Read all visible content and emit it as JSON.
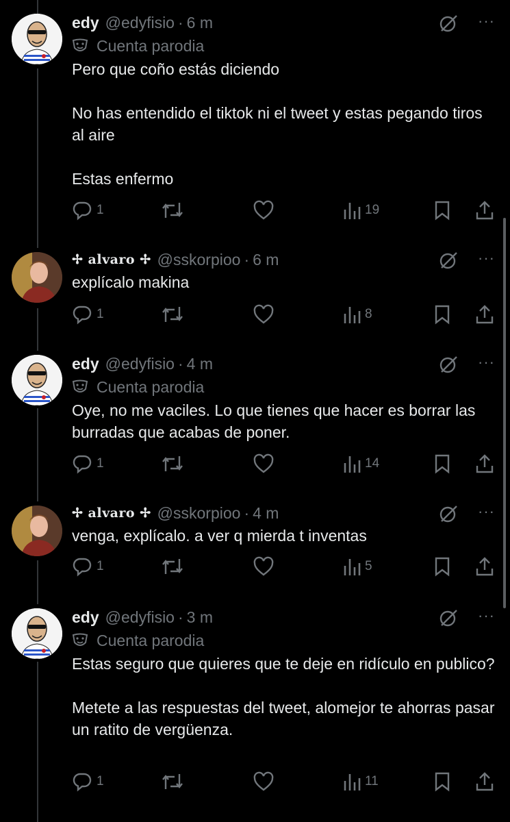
{
  "tweets": [
    {
      "name": "edy",
      "handle": "@edyfisio",
      "time": "6 m",
      "parody_label": "Cuenta parodia",
      "text": "Pero que coño estás diciendo\n\nNo has entendido el tiktok ni el tweet y estas pegando tiros al aire\n\nEstas enfermo",
      "replies": "1",
      "retweets": "",
      "likes": "",
      "views": "19"
    },
    {
      "name": "✢ alvaro ✢",
      "handle": "@sskorpioo",
      "time": "6 m",
      "text": "explícalo makina",
      "replies": "1",
      "retweets": "",
      "likes": "",
      "views": "8"
    },
    {
      "name": "edy",
      "handle": "@edyfisio",
      "time": "4 m",
      "parody_label": "Cuenta parodia",
      "text": "Oye, no me vaciles. Lo que tienes que hacer es borrar las burradas que acabas de poner.",
      "replies": "1",
      "retweets": "",
      "likes": "",
      "views": "14"
    },
    {
      "name": "✢ alvaro ✢",
      "handle": "@sskorpioo",
      "time": "4 m",
      "text": "venga, explícalo. a ver q mierda t inventas",
      "replies": "1",
      "retweets": "",
      "likes": "",
      "views": "5"
    },
    {
      "name": "edy",
      "handle": "@edyfisio",
      "time": "3 m",
      "parody_label": "Cuenta parodia",
      "text": "Estas seguro que quieres que te deje en ridículo en publico?\n\nMetete a las respuestas del tweet, alomejor te ahorras pasar un ratito de vergüenza.",
      "replies": "1",
      "retweets": "",
      "likes": "",
      "views": "11"
    }
  ],
  "dot_separator": "·",
  "more_glyph": "···",
  "colors": {
    "background": "#000000",
    "text": "#e7e9ea",
    "secondary": "#71767b",
    "thread_line": "#333639"
  },
  "icons": [
    "grok-icon",
    "more-icon",
    "parody-mask-icon",
    "reply-icon",
    "retweet-icon",
    "like-icon",
    "views-icon",
    "bookmark-icon",
    "share-icon"
  ]
}
